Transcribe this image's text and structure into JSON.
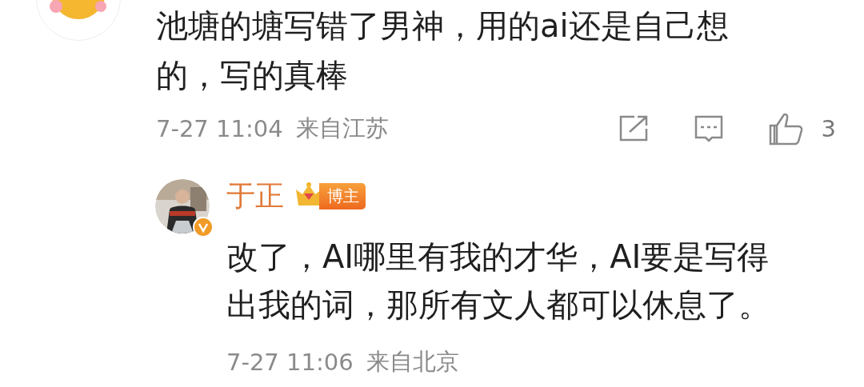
{
  "comment": {
    "text": "池塘的塘写错了男神，用的ai还是自己想的，写的真棒",
    "time": "7-27 11:04",
    "location": "来自江苏",
    "like_count": "3"
  },
  "reply": {
    "author": "于正",
    "badge": "博主",
    "verified": true,
    "text": "改了，AI哪里有我的才华，AI要是写得出我的词，那所有文人都可以休息了。",
    "time": "7-27 11:06",
    "location": "来自北京"
  }
}
